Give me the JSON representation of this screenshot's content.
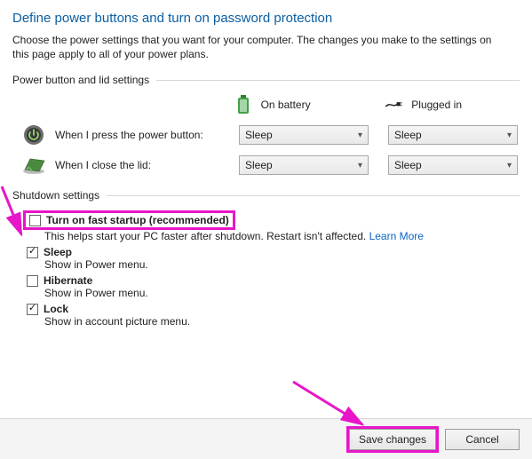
{
  "header": {
    "title": "Define power buttons and turn on password protection",
    "description": "Choose the power settings that you want for your computer. The changes you make to the settings on this page apply to all of your power plans."
  },
  "sections": {
    "power_button_lid": "Power button and lid settings",
    "shutdown": "Shutdown settings"
  },
  "columns": {
    "battery": "On battery",
    "plugged": "Plugged in"
  },
  "rows": {
    "power_button": {
      "label": "When I press the power button:",
      "battery": "Sleep",
      "plugged": "Sleep"
    },
    "lid": {
      "label": "When I close the lid:",
      "battery": "Sleep",
      "plugged": "Sleep"
    }
  },
  "options": {
    "fast_startup": {
      "label": "Turn on fast startup (recommended)",
      "sub_prefix": "This helps start your PC faster after shutdown. Restart isn't affected. ",
      "link": "Learn More",
      "checked": false
    },
    "sleep": {
      "label": "Sleep",
      "sub": "Show in Power menu.",
      "checked": true
    },
    "hibernate": {
      "label": "Hibernate",
      "sub": "Show in Power menu.",
      "checked": false
    },
    "lock": {
      "label": "Lock",
      "sub": "Show in account picture menu.",
      "checked": true
    }
  },
  "footer": {
    "save": "Save changes",
    "cancel": "Cancel"
  }
}
